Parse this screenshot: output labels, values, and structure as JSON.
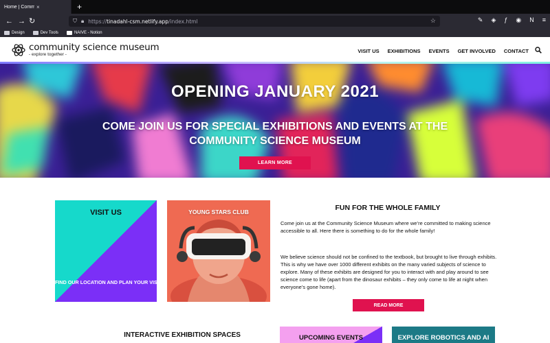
{
  "browser": {
    "tab_title": "Home | Community Science Museum",
    "tab_close": "×",
    "new_tab": "+",
    "url_protocol": "https://",
    "url_host": "tinadahl-csm.netlify.app",
    "url_path": "/index.html",
    "bookmarks": [
      "Design",
      "Dev Tools",
      "NAIVE - Notion"
    ]
  },
  "site": {
    "logo_title": "community science museum",
    "logo_tagline": "- explore together -",
    "nav": [
      "VISIT US",
      "EXHIBITIONS",
      "EVENTS",
      "GET INVOLVED",
      "CONTACT"
    ]
  },
  "hero": {
    "title": "OPENING JANUARY 2021",
    "subtitle": "COME JOIN US FOR SPECIAL EXHIBITIONS AND EVENTS AT THE COMMUNITY SCIENCE MUSEUM",
    "button": "LEARN MORE"
  },
  "cards": {
    "visit_title": "VISIT US",
    "visit_sub": "FIND OUR LOCATION AND PLAN YOUR VISIT",
    "young_title": "YOUNG STARS CLUB"
  },
  "about": {
    "title": "FUN FOR THE WHOLE FAMILY",
    "p1": "Come join us at the Community Science Museum where we’re committed to making science accessible to all. Here there is something to do for the whole family!",
    "p2": "We believe science should not be confined to the textbook, but brought to live through exhibits. This is why we have over 1000 different exhibits on the many varied subjects of science to explore. Many of these exhibits are designed for you to interact with and play around to see science come to life (apart from the dinosaur exhibits – they only come to life at night when everyone’s gone home).",
    "button": "READ MORE"
  },
  "bottom": {
    "interactive_title": "INTERACTIVE EXHIBITION SPACES",
    "upcoming": "UPCOMING EVENTS",
    "robotics": "EXPLORE ROBOTICS AND AI"
  },
  "colors": {
    "accent": "#e0124f",
    "teal": "#16d9cb",
    "purple": "#7b2ff7",
    "coral": "#ef6a52",
    "pink": "#f4a0ef",
    "dark_teal": "#1c7a86"
  }
}
